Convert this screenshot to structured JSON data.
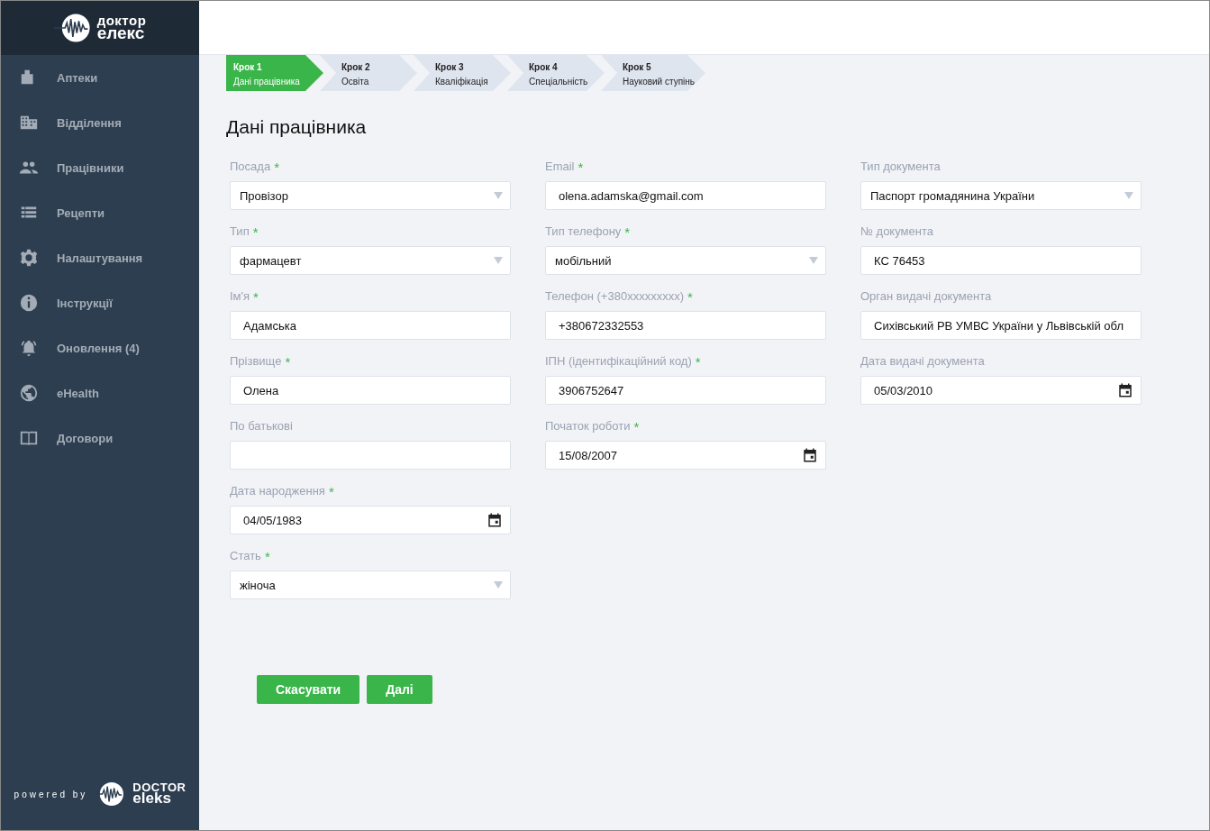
{
  "sidebar": {
    "logo": {
      "line_1": "доктор",
      "line_2": "елекс"
    },
    "items": [
      {
        "label": "Аптеки"
      },
      {
        "label": "Відділення"
      },
      {
        "label": "Працівники"
      },
      {
        "label": "Рецепти"
      },
      {
        "label": "Налаштування"
      },
      {
        "label": "Інструкції"
      },
      {
        "label": "Оновлення (4)"
      },
      {
        "label": "eHealth"
      },
      {
        "label": "Договори"
      }
    ],
    "footer": {
      "prefix": "powered by",
      "line_1": "DOCTOR",
      "line_2": "eleks"
    }
  },
  "steps": [
    {
      "step": "Крок 1",
      "label": "Дані працівника",
      "selected": true
    },
    {
      "step": "Крок 2",
      "label": "Освіта",
      "selected": false
    },
    {
      "step": "Крок 3",
      "label": "Кваліфікація",
      "selected": false
    },
    {
      "step": "Крок 4",
      "label": "Спеціальність",
      "selected": false
    },
    {
      "step": "Крок 5",
      "label": "Науковий ступінь",
      "selected": false
    }
  ],
  "title": "Дані працівника",
  "columns": [
    [
      {
        "label": "Посада",
        "required": true,
        "kind": "select",
        "value": "Провізор"
      },
      {
        "label": "Тип",
        "required": true,
        "kind": "select",
        "value": "фармацевт"
      },
      {
        "label": "Ім'я",
        "required": true,
        "kind": "text",
        "value": "Адамська"
      },
      {
        "label": "Прізвище",
        "required": true,
        "kind": "text",
        "value": "Олена"
      },
      {
        "label": "По батькові",
        "required": false,
        "kind": "text"
      },
      {
        "label": "Дата народження",
        "required": true,
        "kind": "date",
        "value": "04/05/1983"
      },
      {
        "label": "Стать",
        "required": true,
        "kind": "select",
        "value": "жіноча"
      }
    ],
    [
      {
        "label": "Email",
        "required": true,
        "kind": "text",
        "value": "olena.adamska@gmail.com"
      },
      {
        "label": "Тип телефону",
        "required": true,
        "kind": "select",
        "value": "мобільний"
      },
      {
        "label": "Телефон (+380xxxxxxxxx)",
        "required": true,
        "kind": "text",
        "value": "+380672332553"
      },
      {
        "label": "ІПН (ідентифікаційний код)",
        "required": true,
        "kind": "text",
        "value": "3906752647"
      },
      {
        "label": "Початок роботи",
        "required": true,
        "kind": "date",
        "value": "15/08/2007"
      }
    ],
    [
      {
        "label": "Тип документа",
        "required": false,
        "kind": "select",
        "value": "Паспорт громадянина України"
      },
      {
        "label": "№ документа",
        "required": false,
        "kind": "text",
        "value": "КС 76453"
      },
      {
        "label": "Орган видачі документа",
        "required": false,
        "kind": "text",
        "value": "Сихівський РВ УМВС України у Львівській обл"
      },
      {
        "label": "Дата видачі документа",
        "required": false,
        "kind": "date",
        "value": "05/03/2010"
      }
    ]
  ],
  "required_mark": "*",
  "buttons": [
    "Скасувати",
    "Далі"
  ]
}
